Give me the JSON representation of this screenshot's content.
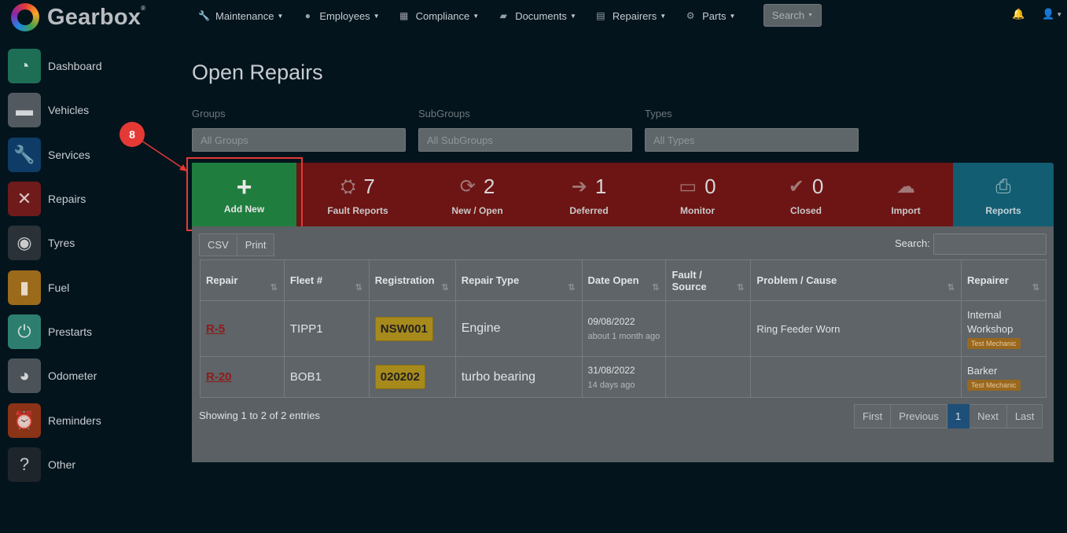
{
  "app": {
    "logo_text": "Gearbox"
  },
  "topnav": {
    "items": [
      {
        "label": "Maintenance",
        "icon": "wrench-icon"
      },
      {
        "label": "Employees",
        "icon": "user-circle-icon"
      },
      {
        "label": "Compliance",
        "icon": "calendar-icon"
      },
      {
        "label": "Documents",
        "icon": "folder-icon"
      },
      {
        "label": "Repairers",
        "icon": "address-card-icon"
      },
      {
        "label": "Parts",
        "icon": "gear-icon"
      }
    ],
    "search_label": "Search"
  },
  "sidebar": {
    "items": [
      {
        "label": "Dashboard",
        "icon": "gauge-icon",
        "color": "#1d6e55"
      },
      {
        "label": "Vehicles",
        "icon": "truck-icon",
        "color": "#525a60"
      },
      {
        "label": "Services",
        "icon": "wrench-icon",
        "color": "#0f3c66"
      },
      {
        "label": "Repairs",
        "icon": "tools-icon",
        "color": "#701b1b"
      },
      {
        "label": "Tyres",
        "icon": "tyre-icon",
        "color": "#2a3137"
      },
      {
        "label": "Fuel",
        "icon": "fuel-pump-icon",
        "color": "#9b6a1b"
      },
      {
        "label": "Prestarts",
        "icon": "power-icon",
        "color": "#2d7e6e"
      },
      {
        "label": "Odometer",
        "icon": "odometer-icon",
        "color": "#4c5358"
      },
      {
        "label": "Reminders",
        "icon": "alarm-clock-icon",
        "color": "#8a3316"
      },
      {
        "label": "Other",
        "icon": "question-icon",
        "color": "#1f262b"
      }
    ]
  },
  "main": {
    "title": "Open Repairs",
    "filters": [
      {
        "label": "Groups",
        "placeholder": "All Groups"
      },
      {
        "label": "SubGroups",
        "placeholder": "All SubGroups"
      },
      {
        "label": "Types",
        "placeholder": "All Types"
      }
    ],
    "add_new_label": "Add New",
    "stats": [
      {
        "label": "Fault Reports",
        "count": "7",
        "icon": "engine-icon"
      },
      {
        "label": "New / Open",
        "count": "2",
        "icon": "refresh-icon"
      },
      {
        "label": "Deferred",
        "count": "1",
        "icon": "arrow-circle-icon"
      },
      {
        "label": "Monitor",
        "count": "0",
        "icon": "monitor-icon"
      },
      {
        "label": "Closed",
        "count": "0",
        "icon": "check-circle-icon"
      },
      {
        "label": "Import",
        "count": "",
        "icon": "cloud-upload-icon"
      }
    ],
    "reports_label": "Reports",
    "annotation_number": "8",
    "export_buttons": [
      "CSV",
      "Print"
    ],
    "search_label": "Search:",
    "table": {
      "columns": [
        "Repair",
        "Fleet #",
        "Registration",
        "Repair Type",
        "Date Open",
        "Fault / Source",
        "Problem / Cause",
        "Repairer"
      ],
      "rows": [
        {
          "repair": "R-5",
          "fleet": "TIPP1",
          "registration": "NSW001",
          "repair_type": "Engine",
          "date_open": "09/08/2022",
          "date_ago": "about 1 month ago",
          "fault_source": "",
          "problem": "Ring Feeder Worn",
          "repairer": "Internal Workshop",
          "repairer_tag": "Test Mechanic"
        },
        {
          "repair": "R-20",
          "fleet": "BOB1",
          "registration": "020202",
          "repair_type": "turbo bearing",
          "date_open": "31/08/2022",
          "date_ago": "14 days ago",
          "fault_source": "",
          "problem": "",
          "repairer": "Barker",
          "repairer_tag": "Test Mechanic"
        }
      ]
    },
    "showing_text": "Showing 1 to 2 of 2 entries",
    "pagination": [
      "First",
      "Previous",
      "1",
      "Next",
      "Last"
    ]
  }
}
